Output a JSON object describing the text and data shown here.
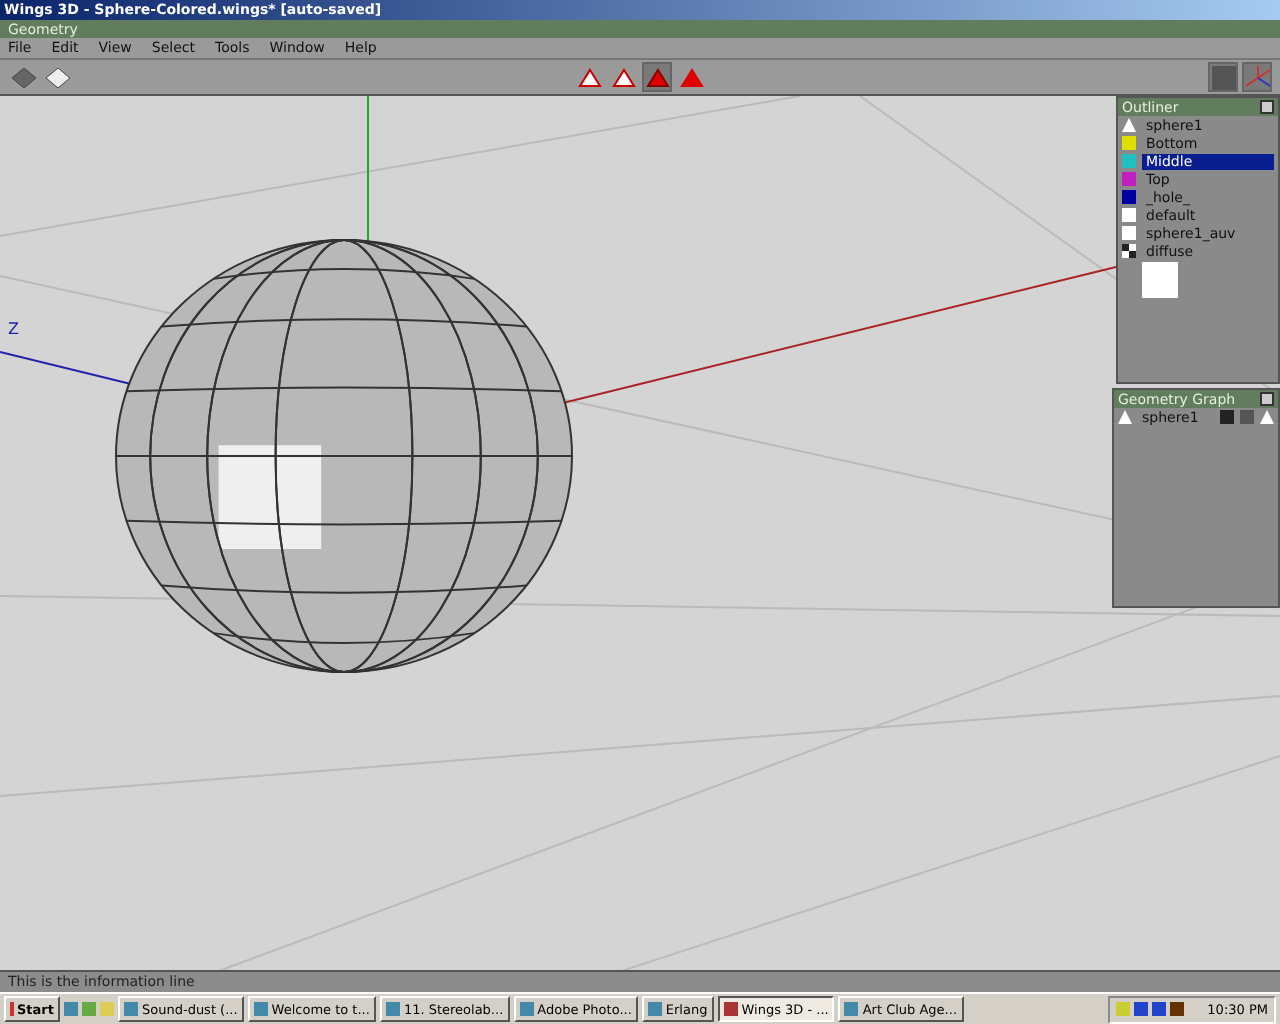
{
  "window": {
    "title": "Wings 3D - Sphere-Colored.wings* [auto-saved]"
  },
  "geometry_bar": {
    "title": "Geometry"
  },
  "menu": [
    "File",
    "Edit",
    "View",
    "Select",
    "Tools",
    "Window",
    "Help"
  ],
  "toolbar": {
    "left_buttons": [
      {
        "kind": "shaded"
      },
      {
        "kind": "wire"
      }
    ],
    "selection_modes": [
      {
        "kind": "vertex",
        "selected": false
      },
      {
        "kind": "edge",
        "selected": false
      },
      {
        "kind": "face",
        "selected": true
      },
      {
        "kind": "body",
        "selected": false
      }
    ],
    "right_buttons": [
      {
        "kind": "render"
      },
      {
        "kind": "axes"
      }
    ]
  },
  "viewport": {
    "axis_label": "Z"
  },
  "outliner": {
    "title": "Outliner",
    "items": [
      {
        "label": "sphere1",
        "kind": "object",
        "selected": false
      },
      {
        "label": "Bottom",
        "kind": "material",
        "color": "#e0e000",
        "selected": false
      },
      {
        "label": "Middle",
        "kind": "material",
        "color": "#20c0c0",
        "selected": true
      },
      {
        "label": "Top",
        "kind": "material",
        "color": "#c020c0",
        "selected": false
      },
      {
        "label": "_hole_",
        "kind": "material",
        "color": "#0000a0",
        "selected": false
      },
      {
        "label": "default",
        "kind": "material",
        "color": "#ffffff",
        "selected": false
      },
      {
        "label": "sphere1_auv",
        "kind": "material",
        "color": "#ffffff",
        "selected": false
      },
      {
        "label": "diffuse",
        "kind": "image",
        "selected": false
      }
    ]
  },
  "geometry_graph": {
    "title": "Geometry Graph",
    "items": [
      {
        "label": "sphere1"
      }
    ]
  },
  "info_line": "This is the information line",
  "taskbar": {
    "start": "Start",
    "tasks": [
      {
        "label": "Sound-dust (...",
        "selected": false
      },
      {
        "label": "Welcome to t...",
        "selected": false
      },
      {
        "label": "11. Stereolab...",
        "selected": false
      },
      {
        "label": "Adobe Photo...",
        "selected": false
      },
      {
        "label": "Erlang",
        "selected": false
      },
      {
        "label": "Wings 3D - ...",
        "selected": true
      },
      {
        "label": "Art Club Age...",
        "selected": false
      }
    ],
    "clock": "10:30 PM"
  }
}
